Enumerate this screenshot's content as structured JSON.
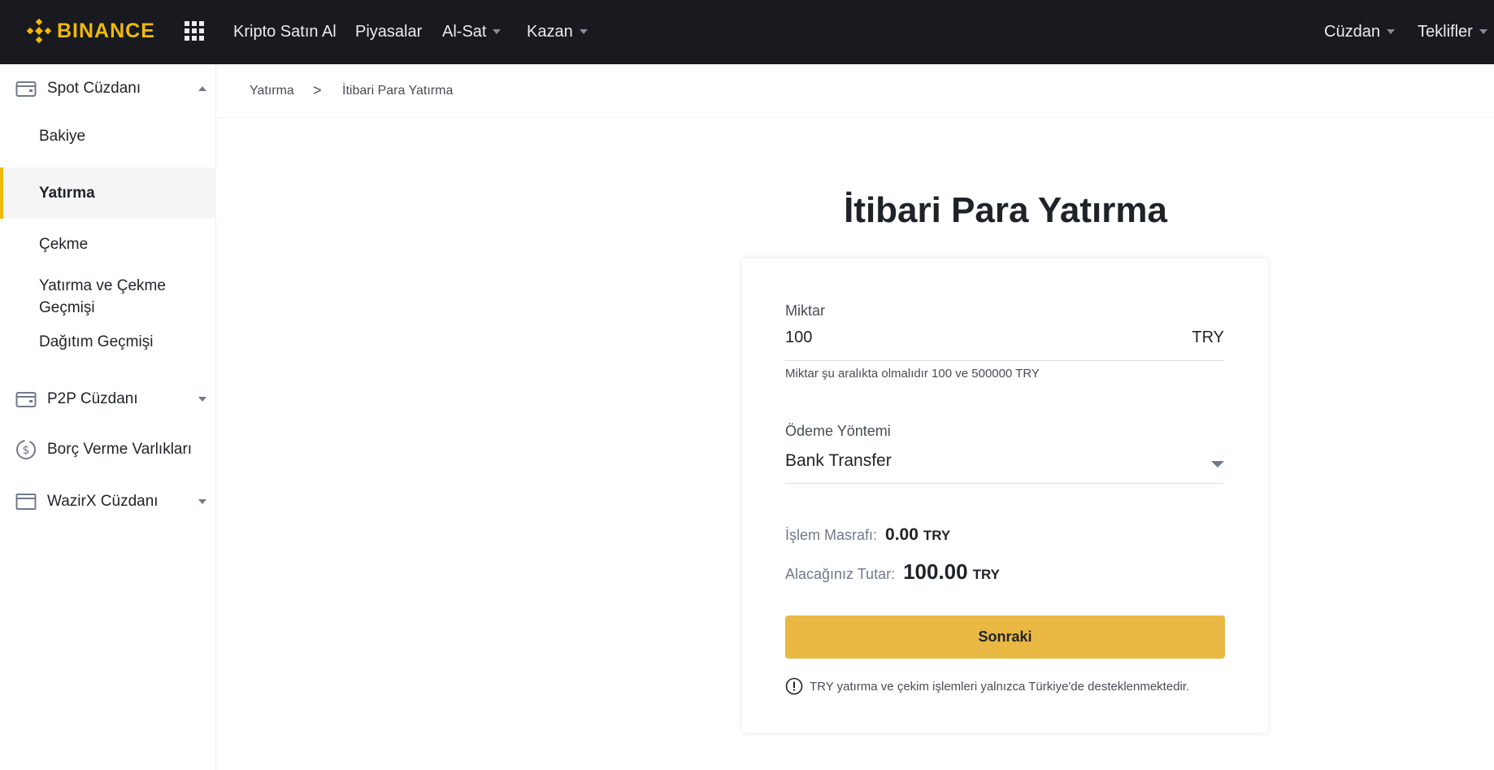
{
  "header": {
    "logo_text": "BINANCE",
    "brand_color": "#f0b90b",
    "nav": [
      {
        "label": "Kripto Satın Al",
        "has_caret": false
      },
      {
        "label": "Piyasalar",
        "has_caret": false
      },
      {
        "label": "Al-Sat",
        "has_caret": true
      },
      {
        "label": "Kazan",
        "has_caret": true
      }
    ],
    "right_nav": [
      {
        "label": "Cüzdan",
        "has_caret": true
      },
      {
        "label": "Teklifler",
        "has_caret": true
      }
    ],
    "apps_icon": "grid-icon"
  },
  "sidebar": {
    "groups": [
      {
        "label": "Spot Cüzdanı",
        "icon": "wallet-icon",
        "expanded": true
      },
      {
        "label": "P2P Cüzdanı",
        "icon": "wallet-icon",
        "expanded": false
      },
      {
        "label": "Borç Verme Varlıkları",
        "icon": "dollar-coin-icon",
        "expanded": false
      },
      {
        "label": "WazirX Cüzdanı",
        "icon": "card-wallet-icon",
        "expanded": false
      }
    ],
    "spot_items": [
      {
        "label": "Bakiye",
        "active": false
      },
      {
        "label": "Yatırma",
        "active": true
      },
      {
        "label": "Çekme",
        "active": false
      },
      {
        "label": "Yatırma ve Çekme Geçmişi",
        "active": false
      },
      {
        "label": "Dağıtım Geçmişi",
        "active": false
      }
    ]
  },
  "breadcrumb": {
    "items": [
      "Yatırma",
      "İtibari Para Yatırma"
    ],
    "separator": ">"
  },
  "main": {
    "title": "İtibari Para Yatırma",
    "amount": {
      "label": "Miktar",
      "value": "100",
      "currency": "TRY",
      "hint": "Miktar şu aralıkta olmalıdır 100 ve 500000 TRY"
    },
    "payment": {
      "label": "Ödeme Yöntemi",
      "selected": "Bank Transfer"
    },
    "fee": {
      "label": "İşlem Masrafı:",
      "value": "0.00",
      "currency": "TRY"
    },
    "receive": {
      "label": "Alacağınız Tutar:",
      "value": "100.00",
      "currency": "TRY"
    },
    "next_button": "Sonraki",
    "button_color": "#e9b843",
    "notice": "TRY yatırma ve çekim işlemleri yalnızca Türkiye'de desteklenmektedir."
  }
}
